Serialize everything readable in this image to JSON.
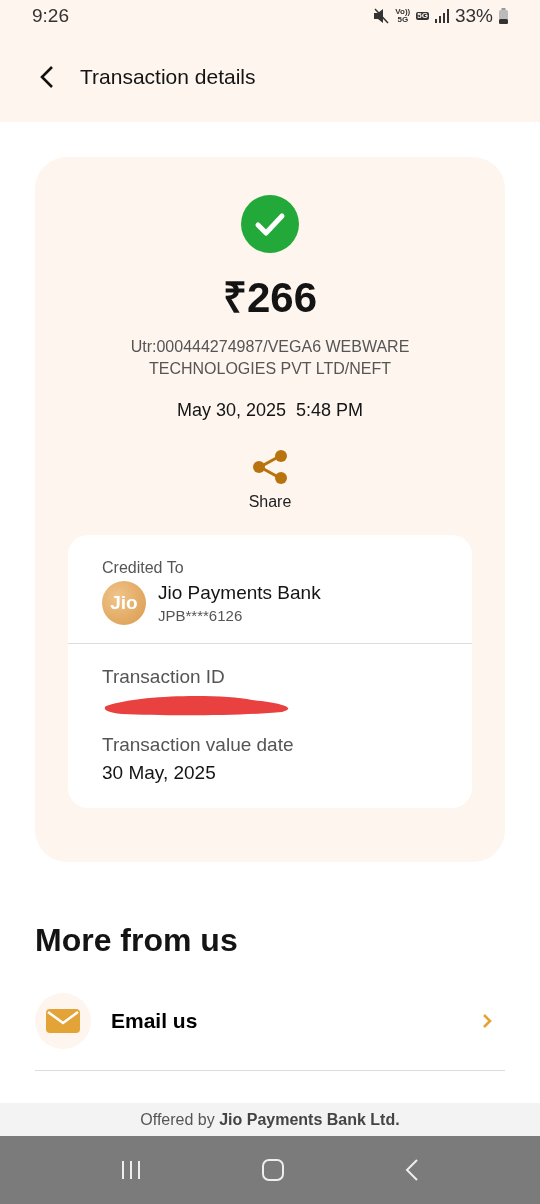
{
  "status_bar": {
    "time": "9:26",
    "volte_text": "Vo))",
    "volte_sub": "5G",
    "data_text": "5G",
    "battery": "33%"
  },
  "header": {
    "title": "Transaction details"
  },
  "transaction": {
    "succeeded": true,
    "amount": "₹266",
    "reference": "Utr:000444274987/VEGA6 WEBWARE TECHNOLOGIES PVT LTD/NEFT",
    "date": "May 30, 2025",
    "time": "5:48 PM",
    "share_label": "Share"
  },
  "credited": {
    "label": "Credited To",
    "logo_text": "Jio",
    "bank": "Jio Payments Bank",
    "account": "JPB****6126"
  },
  "details": [
    {
      "label": "Transaction ID",
      "redacted": true
    },
    {
      "label": "Transaction value date",
      "value": "30 May, 2025",
      "redacted": false
    }
  ],
  "more": {
    "title": "More from us",
    "items": [
      {
        "label": "Email us",
        "kind": "email"
      }
    ]
  },
  "footer": {
    "text": "Offered by **Jio Payments Bank Ltd.**"
  }
}
